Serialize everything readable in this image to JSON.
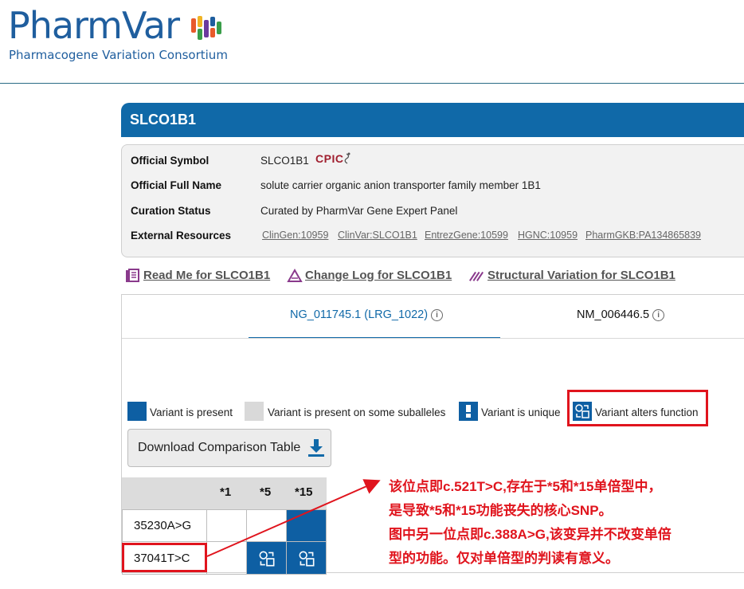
{
  "header": {
    "logo_text": "PharmVar",
    "logo_subtitle": "Pharmacogene Variation Consortium",
    "logo_colors": [
      "#e85a2a",
      "#f0b324",
      "#3a9e4a",
      "#6b3a9e",
      "#1f5e9e"
    ]
  },
  "gene": {
    "symbol_title": "SLCO1B1",
    "info": [
      {
        "label": "Official Symbol",
        "value": "SLCO1B1"
      },
      {
        "label": "Official Full Name",
        "value": "solute carrier organic anion transporter family member 1B1"
      },
      {
        "label": "Curation Status",
        "value": "Curated by PharmVar Gene Expert Panel"
      },
      {
        "label": "External Resources",
        "value": ""
      }
    ],
    "cpic_badge": "CPIC",
    "external_links": [
      "ClinGen:10959",
      "ClinVar:SLCO1B1",
      "EntrezGene:10599",
      "HGNC:10959",
      "PharmGKB:PA134865839"
    ]
  },
  "quick_links": {
    "readme": "Read Me for SLCO1B1",
    "changelog": "Change Log for SLCO1B1",
    "structural": "Structural Variation for SLCO1B1"
  },
  "tabs": {
    "ng": "NG_011745.1 (LRG_1022)",
    "nm": "NM_006446.5",
    "active": "ng"
  },
  "legend": {
    "present": "Variant is present",
    "some_suballeles": "Variant is present on some suballeles",
    "unique": "Variant is unique",
    "alters_function": "Variant alters function"
  },
  "download_button": "Download Comparison Table",
  "table": {
    "columns": [
      "*1",
      "*5",
      "*15"
    ],
    "rows": [
      {
        "variant": "35230A>G",
        "cells": [
          "empty",
          "empty",
          "present"
        ]
      },
      {
        "variant": "37041T>C",
        "cells": [
          "empty",
          "alters_function",
          "alters_function"
        ]
      }
    ]
  },
  "annotation": {
    "lines": [
      "该位点即c.521T>C,存在于*5和*15单倍型中，",
      "是导致*5和*15功能丧失的核心SNP。",
      "图中另一位点即c.388A>G,该变异并不改变单倍",
      "型的功能。仅对单倍型的判读有意义。"
    ]
  },
  "colors": {
    "brand_blue": "#1069a8",
    "present_blue": "#0e5fa3",
    "suballele_gray": "#d9d9d9",
    "annotation_red": "#e0141d",
    "cpic_red": "#a01f2f"
  }
}
